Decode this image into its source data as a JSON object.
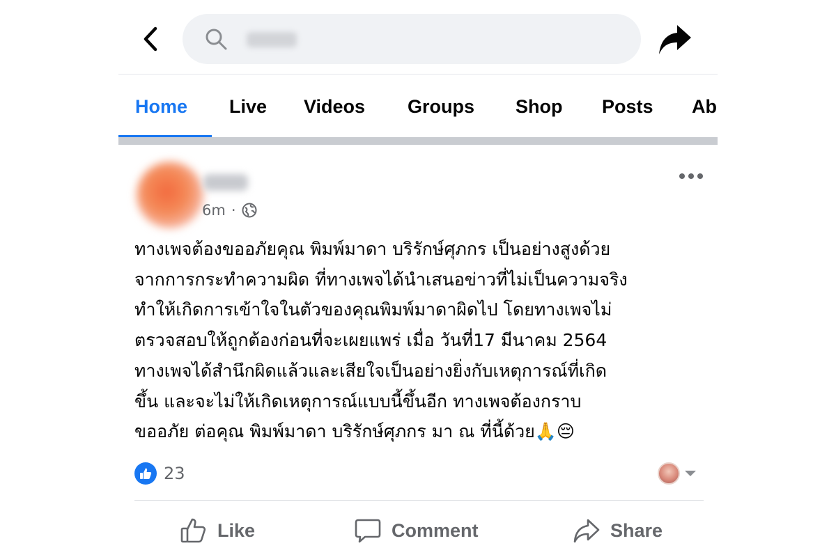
{
  "search": {
    "placeholder": "",
    "value": ""
  },
  "tabs": [
    {
      "label": "Home",
      "active": true
    },
    {
      "label": "Live",
      "active": false
    },
    {
      "label": "Videos",
      "active": false
    },
    {
      "label": "Groups",
      "active": false
    },
    {
      "label": "Shop",
      "active": false
    },
    {
      "label": "Posts",
      "active": false
    },
    {
      "label": "Ab",
      "active": false
    }
  ],
  "post": {
    "time": "6m",
    "separator": "·",
    "privacy_icon": "globe-icon",
    "text": "ทางเพจต้องขออภัยคุณ พิมพ์มาดา บริรักษ์ศุภกร เป็นอย่างสูงด้วย\nจากการกระทำความผิด ที่ทางเพจได้นำเสนอข่าวที่ไม่เป็นความจริง\nทำให้เกิดการเข้าใจในตัวของคุณพิมพ์มาดาผิดไป โดยทางเพจไม่\nตรวจสอบให้ถูกต้องก่อนที่จะเผยแพร่ เมื่อ วันที่17 มีนาคม 2564\nทางเพจได้สำนึกผิดแล้วและเสียใจเป็นอย่างยิ่งกับเหตุการณ์ที่เกิด\nขึ้น และจะไม่ให้เกิดเหตุการณ์แบบนี้ขึ้นอีก ทางเพจต้องกราบ\nขออภัย ต่อคุณ พิมพ์มาดา บริรักษ์ศุภกร มา ณ ที่นี้ด้วย🙏😔",
    "reactions_count": "23"
  },
  "actions": {
    "like": "Like",
    "comment": "Comment",
    "share": "Share"
  },
  "colors": {
    "accent": "#1877f2",
    "muted_text": "#65676b",
    "separator": "#c9ccd1"
  }
}
